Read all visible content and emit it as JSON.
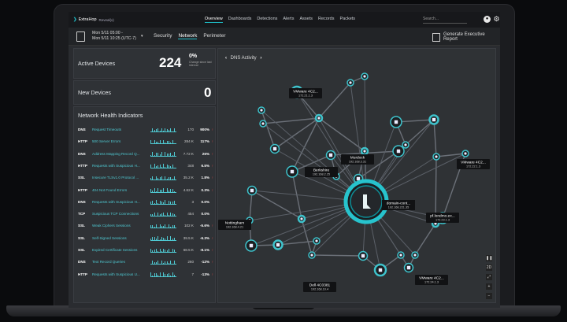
{
  "nav": {
    "brand": "ExtraHop",
    "brand_sub": "Reveal(x)",
    "links": [
      "Overview",
      "Dashboards",
      "Detections",
      "Alerts",
      "Assets",
      "Records",
      "Packets"
    ],
    "active_link": "Overview",
    "search_placeholder": "Search..."
  },
  "subheader": {
    "date_line1": "Mon 5/11 05:00 -",
    "date_line2": "Mon 5/11 10:25 (UTC-7)",
    "tabs": [
      "Security",
      "Network",
      "Perimeter"
    ],
    "active_tab": "Network",
    "report_label": "Generate Executive Report"
  },
  "active_devices": {
    "title": "Active Devices",
    "value": "224",
    "change": "0%",
    "change_sub": "Change since last interval"
  },
  "new_devices": {
    "title": "New Devices",
    "value": "0"
  },
  "health": {
    "title": "Network Health Indicators",
    "rows": [
      {
        "proto": "DNS",
        "metric": "Request Timeouts",
        "value": "170",
        "pct": "900%",
        "up": true
      },
      {
        "proto": "HTTP",
        "metric": "500 Server Errors",
        "value": "284 K",
        "pct": "117%",
        "up": true
      },
      {
        "proto": "DNS",
        "metric": "Address Mapping Record Q...",
        "value": "7.72 K",
        "pct": "26%",
        "up": true
      },
      {
        "proto": "HTTP",
        "metric": "Requests with Suspicious H...",
        "value": "348",
        "pct": "6.5%",
        "up": true
      },
      {
        "proto": "SSL",
        "metric": "Insecure TLSv1.0 Protocol ...",
        "value": "35.2 K",
        "pct": "1.8%",
        "up": true
      },
      {
        "proto": "HTTP",
        "metric": "404 Not Found Errors",
        "value": "4.62 K",
        "pct": "0.3%",
        "up": true
      },
      {
        "proto": "DNS",
        "metric": "Requests with Suspicious H...",
        "value": "3",
        "pct": "0.0%",
        "up": false
      },
      {
        "proto": "TCP",
        "metric": "Suspicious TCP Connections",
        "value": "454",
        "pct": "0.0%",
        "up": false
      },
      {
        "proto": "SSL",
        "metric": "Weak Ciphers Sessions",
        "value": "102 K",
        "pct": "-5.6%",
        "up": true
      },
      {
        "proto": "SSL",
        "metric": "Self-Signed Sessions",
        "value": "39.5 K",
        "pct": "-6.3%",
        "up": true
      },
      {
        "proto": "SSL",
        "metric": "Expired Certificate Sessions",
        "value": "68.5 K",
        "pct": "-8.1%",
        "up": true
      },
      {
        "proto": "DNS",
        "metric": "Text Record Queries",
        "value": "260",
        "pct": "-12%",
        "up": true
      },
      {
        "proto": "HTTP",
        "metric": "Requests with Suspicious U...",
        "value": "7",
        "pct": "-13%",
        "up": true
      }
    ]
  },
  "map": {
    "title": "DNS Activity",
    "center_label": "domain-cont...",
    "center_ip": "192.168.221.35",
    "labels": [
      {
        "name": "VMware 4C2...",
        "ip": "172.21.1.3"
      },
      {
        "name": "Murdock",
        "ip": "192.168.3.31"
      },
      {
        "name": "Berkshire",
        "ip": "192.168.2.25"
      },
      {
        "name": "VMware 4C2...",
        "ip": "172.22.1.3"
      },
      {
        "name": "pf.londmo.ex...",
        "ip": "172.23.1.3"
      },
      {
        "name": "Nottingham",
        "ip": "192.168.4.21"
      },
      {
        "name": "Dell 4C0381",
        "ip": "192.168.10.4"
      },
      {
        "name": "VMware 4C2...",
        "ip": "172.24.1.3"
      }
    ],
    "zoom_labels": [
      "2D",
      "+",
      "−"
    ]
  },
  "colors": {
    "accent": "#1fbec8",
    "panel": "#2f3236",
    "alert_red": "#e04848"
  }
}
